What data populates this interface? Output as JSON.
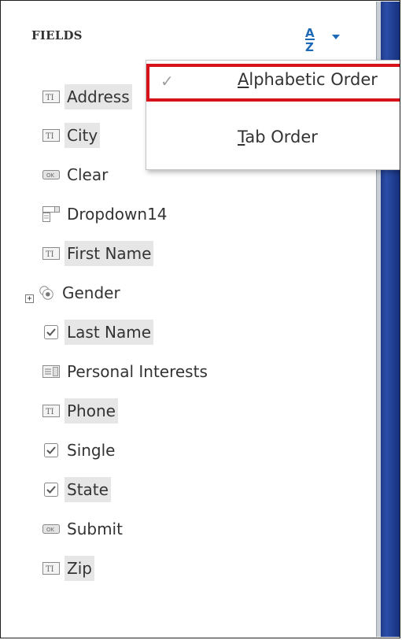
{
  "panel": {
    "title": "FIELDS",
    "sort_icon": "sort-az-icon"
  },
  "fields": [
    {
      "label": "Address",
      "icon": "text-field-icon",
      "highlighted": true
    },
    {
      "label": "City",
      "icon": "text-field-icon",
      "highlighted": true
    },
    {
      "label": "Clear",
      "icon": "button-field-icon",
      "highlighted": false
    },
    {
      "label": "Dropdown14",
      "icon": "dropdown-field-icon",
      "highlighted": false
    },
    {
      "label": "First Name",
      "icon": "text-field-icon",
      "highlighted": true
    },
    {
      "label": "Gender",
      "icon": "radio-group-icon",
      "highlighted": false
    },
    {
      "label": "Last Name",
      "icon": "checkbox-icon",
      "highlighted": true
    },
    {
      "label": "Personal Interests",
      "icon": "list-box-icon",
      "highlighted": false
    },
    {
      "label": "Phone",
      "icon": "text-field-icon",
      "highlighted": true
    },
    {
      "label": "Single",
      "icon": "checkbox-icon",
      "highlighted": false
    },
    {
      "label": "State",
      "icon": "checkbox-icon",
      "highlighted": true
    },
    {
      "label": "Submit",
      "icon": "button-field-icon",
      "highlighted": false
    },
    {
      "label": "Zip",
      "icon": "text-field-icon",
      "highlighted": true
    }
  ],
  "menu": {
    "items": [
      {
        "label_mnemonic": "A",
        "label_rest": "lphabetic Order",
        "checked": true,
        "selected": true
      },
      {
        "label_mnemonic": "T",
        "label_rest": "ab Order",
        "checked": false,
        "selected": false
      }
    ]
  },
  "colors": {
    "highlight_box": "#d8121b",
    "sort_accent": "#1f6ab7",
    "right_edge": "#1f3a8a"
  }
}
